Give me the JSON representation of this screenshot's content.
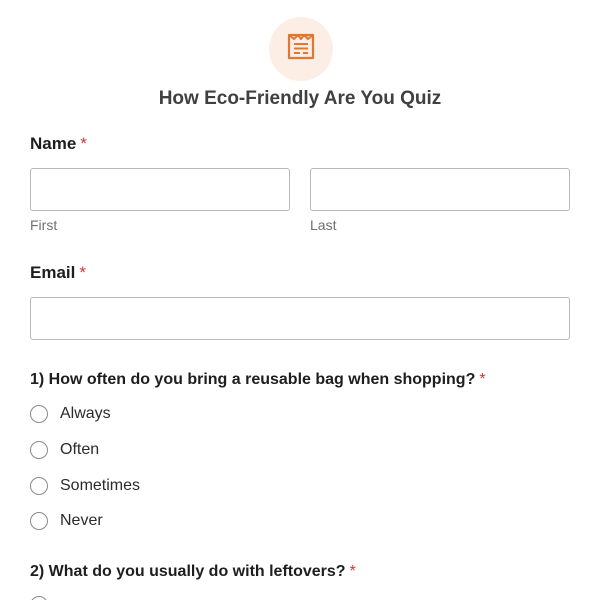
{
  "form": {
    "title": "How Eco-Friendly Are You Quiz",
    "header_icon": "form-document-icon",
    "accent_color": "#e27730",
    "required_marker": "*"
  },
  "name_field": {
    "label": "Name",
    "first_sublabel": "First",
    "last_sublabel": "Last",
    "first_value": "",
    "last_value": ""
  },
  "email_field": {
    "label": "Email",
    "value": ""
  },
  "questions": [
    {
      "text": "1) How often do you bring a reusable bag when shopping?",
      "options": [
        "Always",
        "Often",
        "Sometimes",
        "Never"
      ]
    },
    {
      "text": "2) What do you usually do with leftovers?"
    }
  ]
}
